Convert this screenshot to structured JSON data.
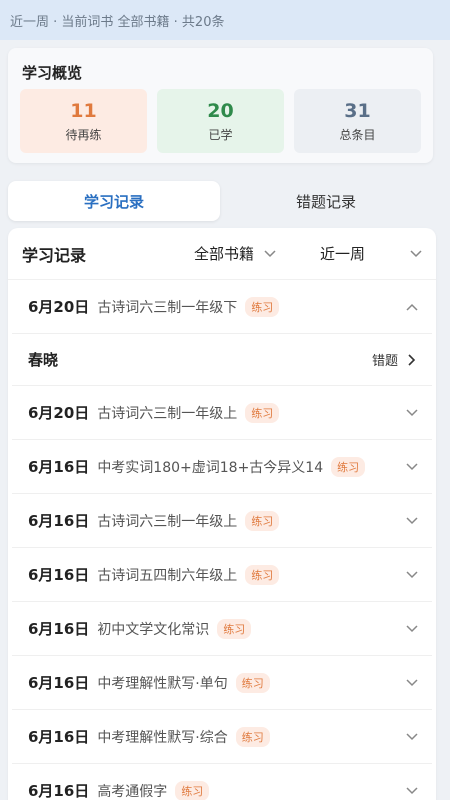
{
  "banner": {
    "text": "近一周 · 当前词书 全部书籍 · 共20条"
  },
  "overview": {
    "title": "学习概览",
    "stats": [
      {
        "value": "11",
        "label": "待再练"
      },
      {
        "value": "20",
        "label": "已学"
      },
      {
        "value": "31",
        "label": "总条目"
      }
    ]
  },
  "tabs": [
    {
      "label": "学习记录",
      "active": true
    },
    {
      "label": "错题记录",
      "active": false
    }
  ],
  "records": {
    "title": "学习记录",
    "filter_book": "全部书籍",
    "filter_period": "近一周",
    "expanded": {
      "date": "6月20日",
      "title": "古诗词六三制一年级下",
      "tag": "练习",
      "detail_title": "春晓",
      "detail_action": "错题"
    },
    "rows": [
      {
        "date": "6月20日",
        "title": "古诗词六三制一年级上",
        "tag": "练习"
      },
      {
        "date": "6月16日",
        "title": "中考实词180+虚词18+古今异义14",
        "tag": "练习"
      },
      {
        "date": "6月16日",
        "title": "古诗词六三制一年级上",
        "tag": "练习"
      },
      {
        "date": "6月16日",
        "title": "古诗词五四制六年级上",
        "tag": "练习"
      },
      {
        "date": "6月16日",
        "title": "初中文学文化常识",
        "tag": "练习"
      },
      {
        "date": "6月16日",
        "title": "中考理解性默写·单句",
        "tag": "练习"
      },
      {
        "date": "6月16日",
        "title": "中考理解性默写·综合",
        "tag": "练习"
      },
      {
        "date": "6月16日",
        "title": "高考通假字",
        "tag": "练习"
      }
    ]
  }
}
